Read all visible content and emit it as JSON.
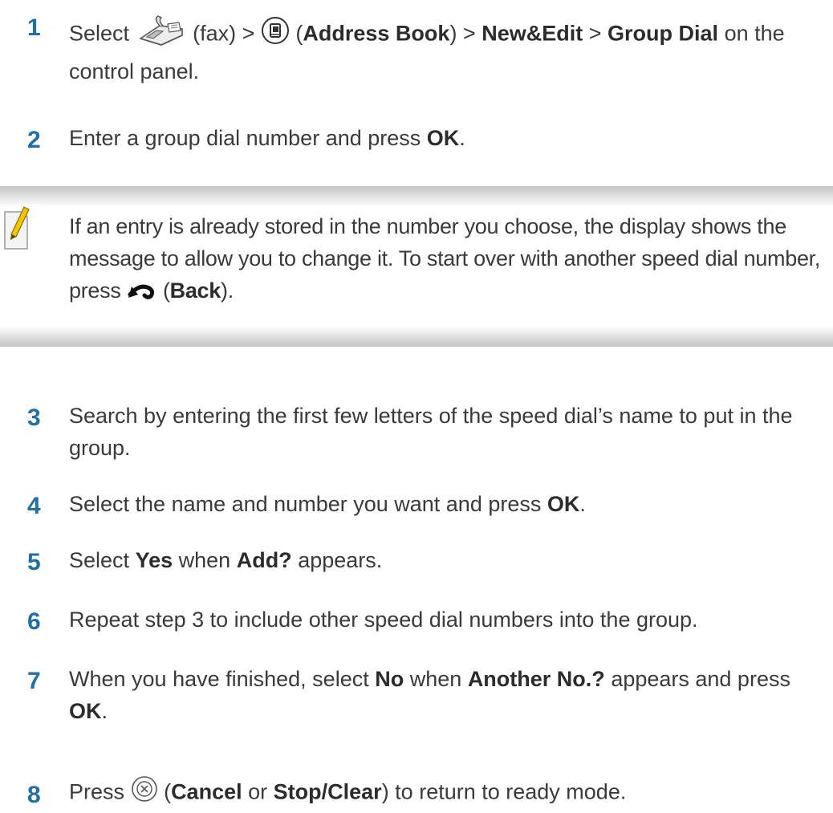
{
  "steps": [
    {
      "num": "1",
      "select": "Select",
      "fax": "(fax) >",
      "open": "(",
      "address_book": "Address Book",
      "close_sep": ") >",
      "new_edit": "New&Edit",
      "sep": ">",
      "group_dial": "Group Dial",
      "tail": "on the control panel."
    },
    {
      "num": "2",
      "pre": "Enter a group dial number and press",
      "ok": "OK",
      "post": "."
    },
    {
      "num": "3",
      "text": "Search by entering the first few letters of the speed dial’s name to put in the group."
    },
    {
      "num": "4",
      "pre": "Select the name and number you want and press",
      "ok": "OK",
      "post": "."
    },
    {
      "num": "5",
      "pre": "Select",
      "yes": "Yes",
      "mid": "when",
      "add": "Add?",
      "post": "appears."
    },
    {
      "num": "6",
      "text": "Repeat step 3 to include other speed dial numbers into the group."
    },
    {
      "num": "7",
      "pre": "When you have finished, select",
      "no": "No",
      "mid": "when",
      "another": "Another No.?",
      "post1": "appears and press",
      "ok": "OK",
      "post2": "."
    },
    {
      "num": "8",
      "pre": "Press",
      "open": "(",
      "cancel": "Cancel",
      "or": "or",
      "stop_clear": "Stop/Clear",
      "post": ") to return to ready mode."
    }
  ],
  "note": {
    "text": "If an entry is already stored in the number you choose, the display shows the message to allow you to change it. To start over with another speed dial number, press",
    "open": "(",
    "back": "Back",
    "close": ")."
  },
  "icons": {
    "fax": "fax-icon",
    "address_book": "address-book-icon",
    "back": "back-arrow-icon",
    "cancel": "cancel-icon",
    "note": "note-pencil-icon"
  },
  "colors": {
    "step_number": "#1f6fa8",
    "text": "#3a3a3a",
    "note_band": "#c4c4c4"
  }
}
